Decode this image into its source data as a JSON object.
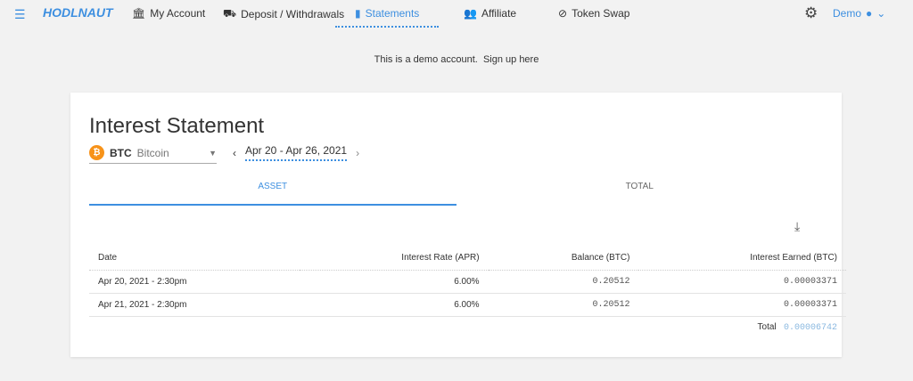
{
  "nav": {
    "logo": "HODLNAUT",
    "items": [
      {
        "label": "My Account",
        "icon": "🏛"
      },
      {
        "label": "Deposit / Withdrawals",
        "icon": "⛟"
      },
      {
        "label": "Statements",
        "icon": "▮"
      },
      {
        "label": "Affiliate",
        "icon": "👥"
      },
      {
        "label": "Token Swap",
        "icon": "⊘"
      }
    ],
    "user": "Demo"
  },
  "banner": {
    "text": "This is a demo account.",
    "link": "Sign up here"
  },
  "card": {
    "title": "Interest Statement",
    "asset_symbol": "BTC",
    "asset_name": "Bitcoin",
    "date_range": "Apr 20 - Apr 26, 2021",
    "tabs": [
      "ASSET",
      "TOTAL"
    ],
    "columns": [
      "Date",
      "Interest Rate (APR)",
      "Balance (BTC)",
      "Interest Earned (BTC)"
    ],
    "rows": [
      [
        "Apr 20, 2021 - 2:30pm",
        "6.00%",
        "0.20512",
        "0.00003371"
      ],
      [
        "Apr 21, 2021 - 2:30pm",
        "6.00%",
        "0.20512",
        "0.00003371"
      ]
    ],
    "total_label": "Total",
    "total_value": "0.00006742"
  }
}
